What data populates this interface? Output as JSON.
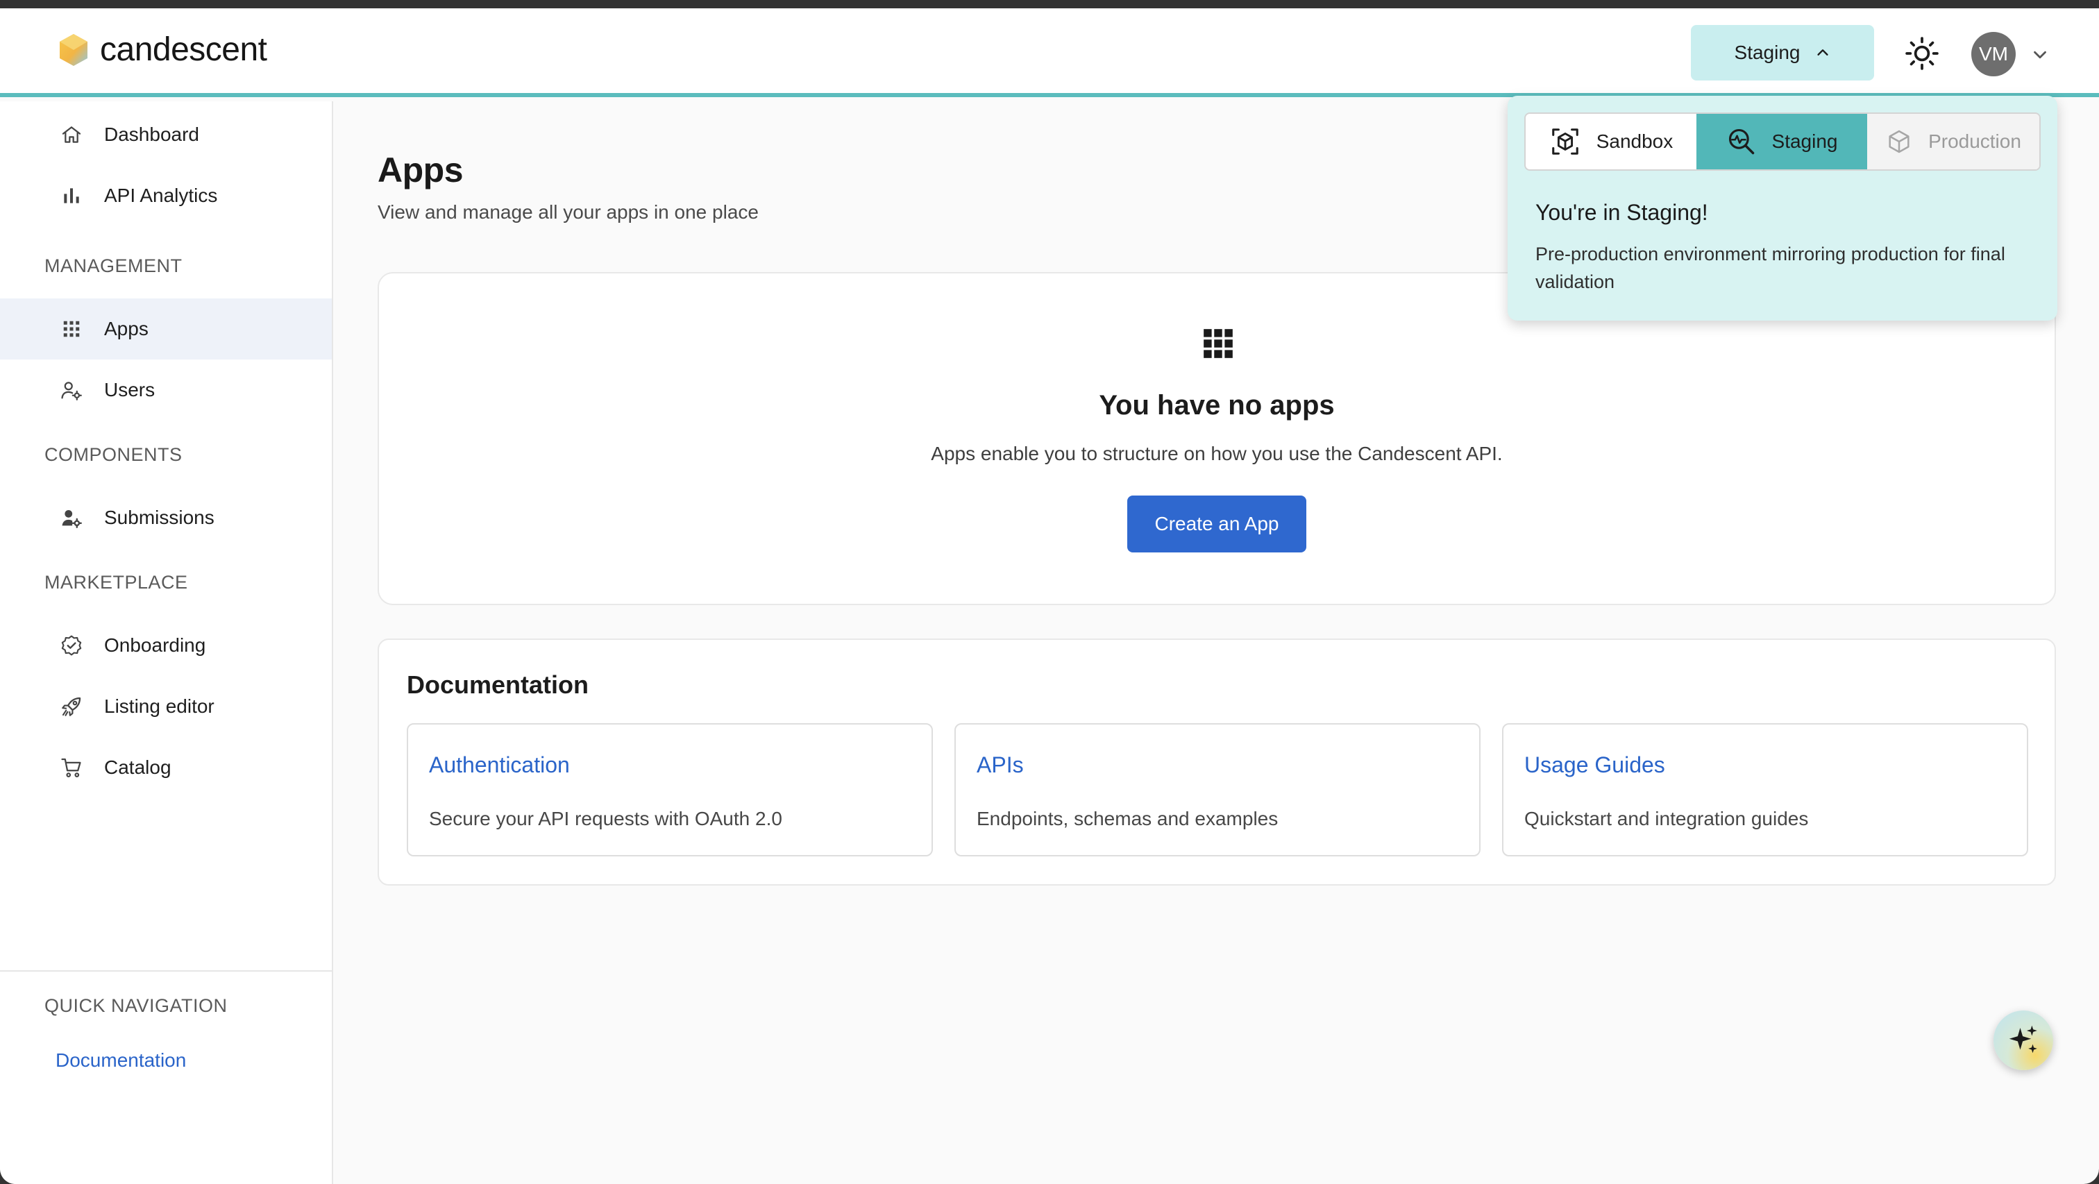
{
  "brand": {
    "name": "candescent"
  },
  "header": {
    "env_selector_label": "Staging",
    "avatar_initials": "VM"
  },
  "sidebar": {
    "top_items": [
      {
        "label": "Dashboard",
        "icon": "home-icon"
      },
      {
        "label": "API Analytics",
        "icon": "bar-chart-icon"
      }
    ],
    "sections": [
      {
        "title": "MANAGEMENT",
        "items": [
          {
            "label": "Apps",
            "icon": "grid-icon",
            "active": true
          },
          {
            "label": "Users",
            "icon": "users-gear-icon"
          }
        ]
      },
      {
        "title": "COMPONENTS",
        "items": [
          {
            "label": "Submissions",
            "icon": "user-gear-icon"
          }
        ]
      },
      {
        "title": "MARKETPLACE",
        "items": [
          {
            "label": "Onboarding",
            "icon": "badge-check-icon"
          },
          {
            "label": "Listing editor",
            "icon": "rocket-icon"
          },
          {
            "label": "Catalog",
            "icon": "cart-icon"
          }
        ]
      }
    ],
    "quick_nav": {
      "title": "QUICK NAVIGATION",
      "link": "Documentation"
    }
  },
  "main": {
    "title": "Apps",
    "subtitle": "View and manage all your apps in one place",
    "empty_state": {
      "title": "You have no apps",
      "description": "Apps enable you to structure on how you use the Candescent API.",
      "cta": "Create an App"
    },
    "documentation": {
      "title": "Documentation",
      "items": [
        {
          "title": "Authentication",
          "description": "Secure your API requests with OAuth 2.0"
        },
        {
          "title": "APIs",
          "description": "Endpoints, schemas and examples"
        },
        {
          "title": "Usage Guides",
          "description": "Quickstart and integration guides"
        }
      ]
    }
  },
  "env_popover": {
    "options": [
      {
        "label": "Sandbox",
        "state": "default",
        "icon": "cube-scan-icon"
      },
      {
        "label": "Staging",
        "state": "active",
        "icon": "search-pulse-icon"
      },
      {
        "label": "Production",
        "state": "disabled",
        "icon": "cube-icon"
      }
    ],
    "title": "You're in Staging!",
    "description": "Pre-production environment mirroring production for final validation"
  },
  "colors": {
    "accent_teal": "#52b7b8",
    "popover_bg": "#d8f3f2",
    "primary_blue": "#2f68cf",
    "link_blue": "#2a64c9"
  }
}
